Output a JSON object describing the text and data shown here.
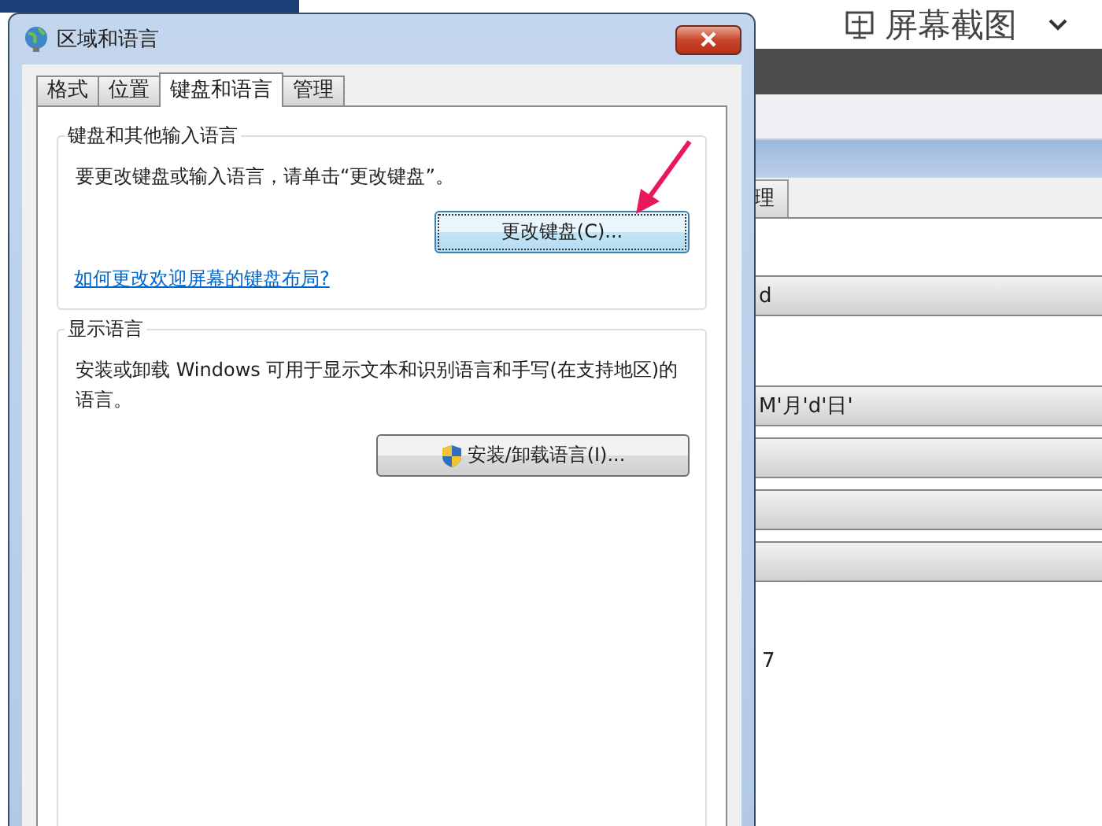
{
  "background": {
    "toolbar": {
      "label": "屏幕截图"
    },
    "window": {
      "tabs": [
        {
          "label": "理",
          "selected": false
        }
      ],
      "combos": [
        {
          "value": "d"
        },
        {
          "value": "M'月'd'日'"
        }
      ],
      "partial_text": "7"
    }
  },
  "dialog": {
    "title": "区域和语言",
    "tabs": [
      {
        "label": "格式",
        "selected": false
      },
      {
        "label": "位置",
        "selected": false
      },
      {
        "label": "键盘和语言",
        "selected": true
      },
      {
        "label": "管理",
        "selected": false
      }
    ],
    "groups": [
      {
        "legend": "键盘和其他输入语言",
        "text": "要更改键盘或输入语言，请单击“更改键盘”。",
        "button": {
          "label": "更改键盘(C)...",
          "focused": true,
          "shield": false
        },
        "link": "如何更改欢迎屏幕的键盘布局?"
      },
      {
        "legend": "显示语言",
        "text": "安装或卸载 Windows 可用于显示文本和识别语言和手写(在支持地区)的语言。",
        "button": {
          "label": "安装/卸载语言(I)...",
          "focused": false,
          "shield": true
        }
      }
    ]
  }
}
